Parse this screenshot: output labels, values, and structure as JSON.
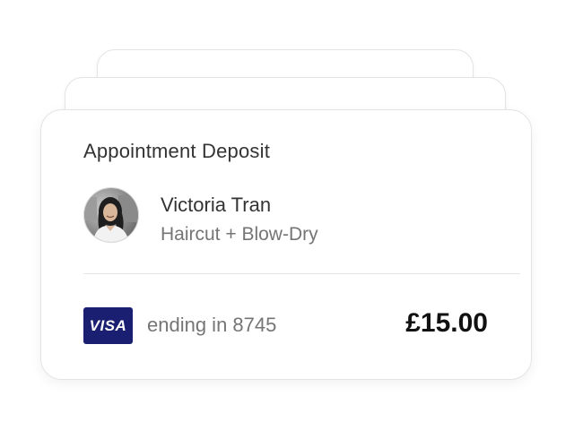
{
  "deposit": {
    "title": "Appointment Deposit",
    "client_name": "Victoria Tran",
    "service": "Haircut + Blow-Dry",
    "card_brand": "VISA",
    "card_ending": "ending in 8745",
    "amount": "£15.00"
  },
  "colors": {
    "visa_blue": "#1a1f71",
    "text_dark": "#333333",
    "text_muted": "#757575",
    "amount_text": "#111111",
    "border": "#e4e4e4"
  }
}
